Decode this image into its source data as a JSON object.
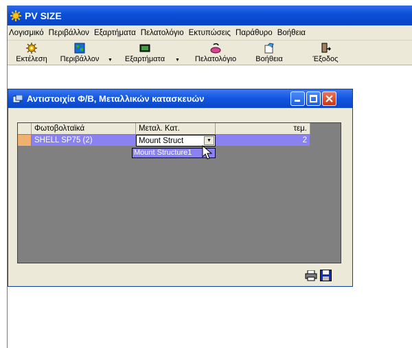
{
  "app": {
    "title": "PV SIZE"
  },
  "menu": [
    "Λογισμικό",
    "Περιβάλλον",
    "Εξαρτήματα",
    "Πελατολόγιο",
    "Εκτυπώσεις",
    "Παράθυρο",
    "Βοήθεια"
  ],
  "toolbar": {
    "run": "Εκτέλεση",
    "environment": "Περιβάλλον",
    "components": "Εξαρτήματα",
    "clients": "Πελατολόγιο",
    "help": "Βοήθεια",
    "exit": "Έξοδος"
  },
  "child": {
    "title": "Αντιστοιχία Φ/Β, Μεταλλικών κατασκευών",
    "columns": [
      "Φωτοβολταϊκά",
      "Μεταλ. Κατ.",
      "τεμ."
    ],
    "row": {
      "pv": "SHELL SP75 (2)",
      "mount": "Mount Struct",
      "qty": "2"
    },
    "dropdown_option": "Mount Structure1"
  },
  "colors": {
    "title_blue": "#0a4fd8",
    "selection": "#8a82f0",
    "row_marker": "#f0b070",
    "grid_bg": "#808080"
  },
  "icons": [
    "sun-icon",
    "run-icon",
    "globe-icon",
    "chip-icon",
    "client-icon",
    "help-icon",
    "exit-icon",
    "window-icon",
    "print-icon",
    "save-icon",
    "mouse-cursor-icon"
  ]
}
